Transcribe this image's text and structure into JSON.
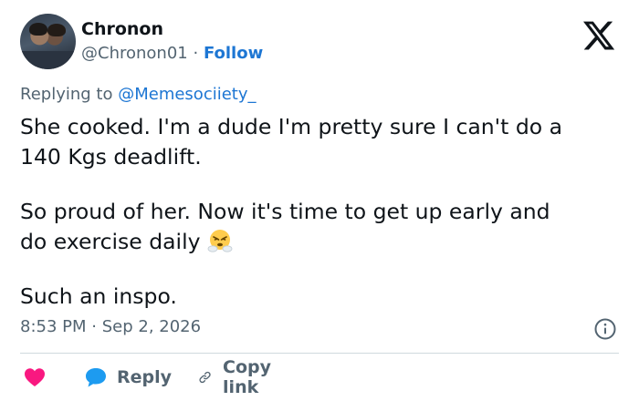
{
  "author": {
    "name": "Chronon",
    "handle": "@Chronon01",
    "separator": "·",
    "follow_label": "Follow"
  },
  "reply_context": {
    "prefix": "Replying to",
    "mention": "@Memesociiety_"
  },
  "tweet": {
    "paragraph1_line1": "She cooked. I'm a dude I'm pretty sure I can't do a",
    "paragraph1_line2": "140 Kgs deadlift.",
    "paragraph2_line1": "So proud of her. Now it's time to get up early and",
    "paragraph2_line2": "do exercise daily",
    "paragraph2_emoji": "face-with-steam-from-nose",
    "paragraph3": "Such an inspo."
  },
  "meta": {
    "time": "8:53 PM",
    "separator": "·",
    "date": "Sep 2, 2026"
  },
  "actions": {
    "like_icon": "heart-icon",
    "reply_label": "Reply",
    "copy_link_label": "Copy link"
  },
  "colors": {
    "accent": "#1d76d3",
    "like": "#f91880",
    "muted": "#536471",
    "text": "#0f1419",
    "divider": "#cfd9de"
  }
}
